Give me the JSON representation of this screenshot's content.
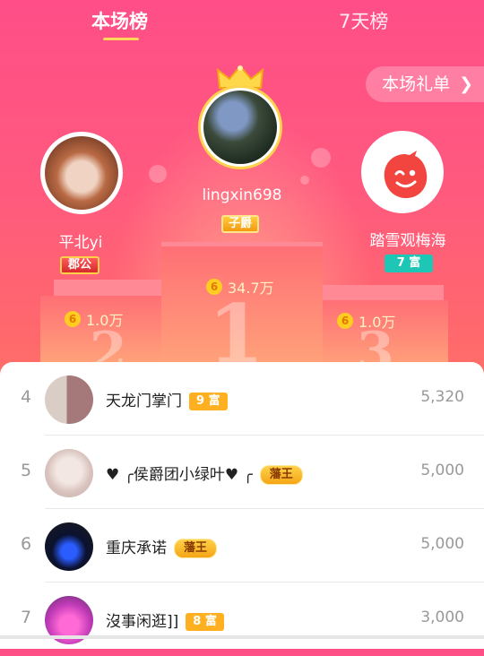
{
  "tabs": [
    {
      "label": "本场榜",
      "active": true
    },
    {
      "label": "7天榜",
      "active": false
    }
  ],
  "gift_button": {
    "label": "本场礼单",
    "icon": "chevron-right-icon"
  },
  "podium": [
    {
      "rank_digit": "1",
      "name": "lingxin698",
      "badge": "子爵",
      "score": "34.7万"
    },
    {
      "rank_digit": "2",
      "name": "平北yi",
      "badge": "郡公",
      "score": "1.0万"
    },
    {
      "rank_digit": "3",
      "name": "踏雪观梅海",
      "badge": "7 富",
      "score": "1.0万"
    }
  ],
  "coin_glyph": "6",
  "list": [
    {
      "rank": "4",
      "name": "天龙门掌门",
      "badge": "9 富",
      "badge_type": "rich",
      "value": "5,320"
    },
    {
      "rank": "5",
      "name": "♥ ╭侯爵团小绿叶♥ ╭",
      "badge": "藩王",
      "badge_type": "king",
      "value": "5,000"
    },
    {
      "rank": "6",
      "name": "重庆承诺",
      "badge": "藩王",
      "badge_type": "king",
      "value": "5,000"
    },
    {
      "rank": "7",
      "name": "沒事闲逛]]",
      "badge": "8 富",
      "badge_type": "rich",
      "value": "3,000"
    }
  ],
  "colors": {
    "accent_gold": "#ffd34d",
    "rich_badge": "#ffb020",
    "teal_badge": "#1ec6b5"
  }
}
